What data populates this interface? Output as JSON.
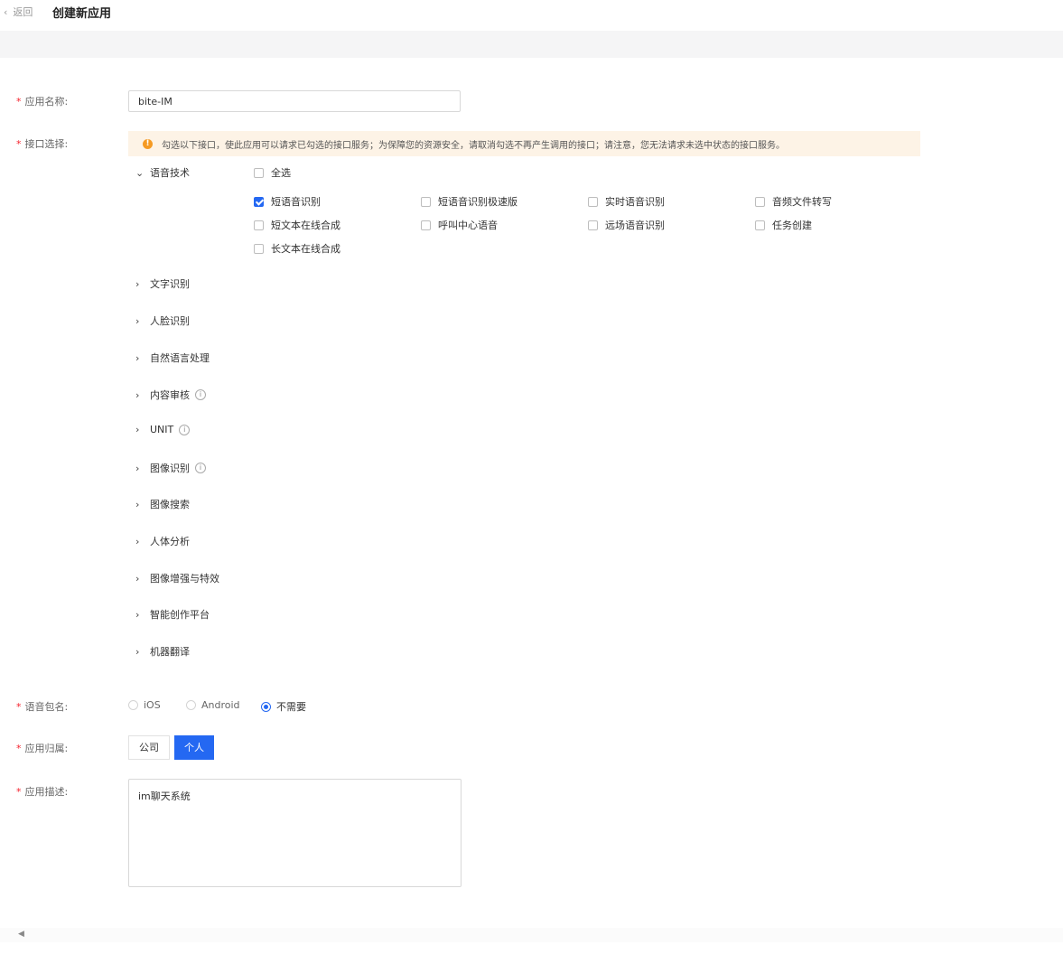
{
  "header": {
    "back_label": "返回",
    "title": "创建新应用"
  },
  "form": {
    "app_name": {
      "label": "应用名称:",
      "value": "bite-IM"
    },
    "interface": {
      "label": "接口选择:",
      "notice": "勾选以下接口，使此应用可以请求已勾选的接口服务；为保障您的资源安全，请取消勾选不再产生调用的接口；请注意，您无法请求未选中状态的接口服务。",
      "expanded_category": "语音技术",
      "select_all": "全选",
      "options": [
        {
          "label": "短语音识别",
          "checked": true
        },
        {
          "label": "短语音识别极速版",
          "checked": false
        },
        {
          "label": "实时语音识别",
          "checked": false
        },
        {
          "label": "音频文件转写",
          "checked": false
        },
        {
          "label": "短文本在线合成",
          "checked": false
        },
        {
          "label": "呼叫中心语音",
          "checked": false
        },
        {
          "label": "远场语音识别",
          "checked": false
        },
        {
          "label": "任务创建",
          "checked": false
        },
        {
          "label": "长文本在线合成",
          "checked": false
        }
      ],
      "categories": [
        "文字识别",
        "人脸识别",
        "自然语言处理",
        "内容审核",
        "UNIT",
        "图像识别",
        "图像搜索",
        "人体分析",
        "图像增强与特效",
        "智能创作平台",
        "机器翻译"
      ]
    },
    "voice_package": {
      "label": "语音包名:",
      "options": [
        "iOS",
        "Android",
        "不需要"
      ],
      "selected": "不需要"
    },
    "ownership": {
      "label": "应用归属:",
      "options": [
        "公司",
        "个人"
      ],
      "selected": "个人"
    },
    "description": {
      "label": "应用描述:",
      "value": "im聊天系统"
    }
  },
  "colors": {
    "primary": "#2468f2",
    "warning": "#f59a23",
    "required": "#f5222d"
  }
}
